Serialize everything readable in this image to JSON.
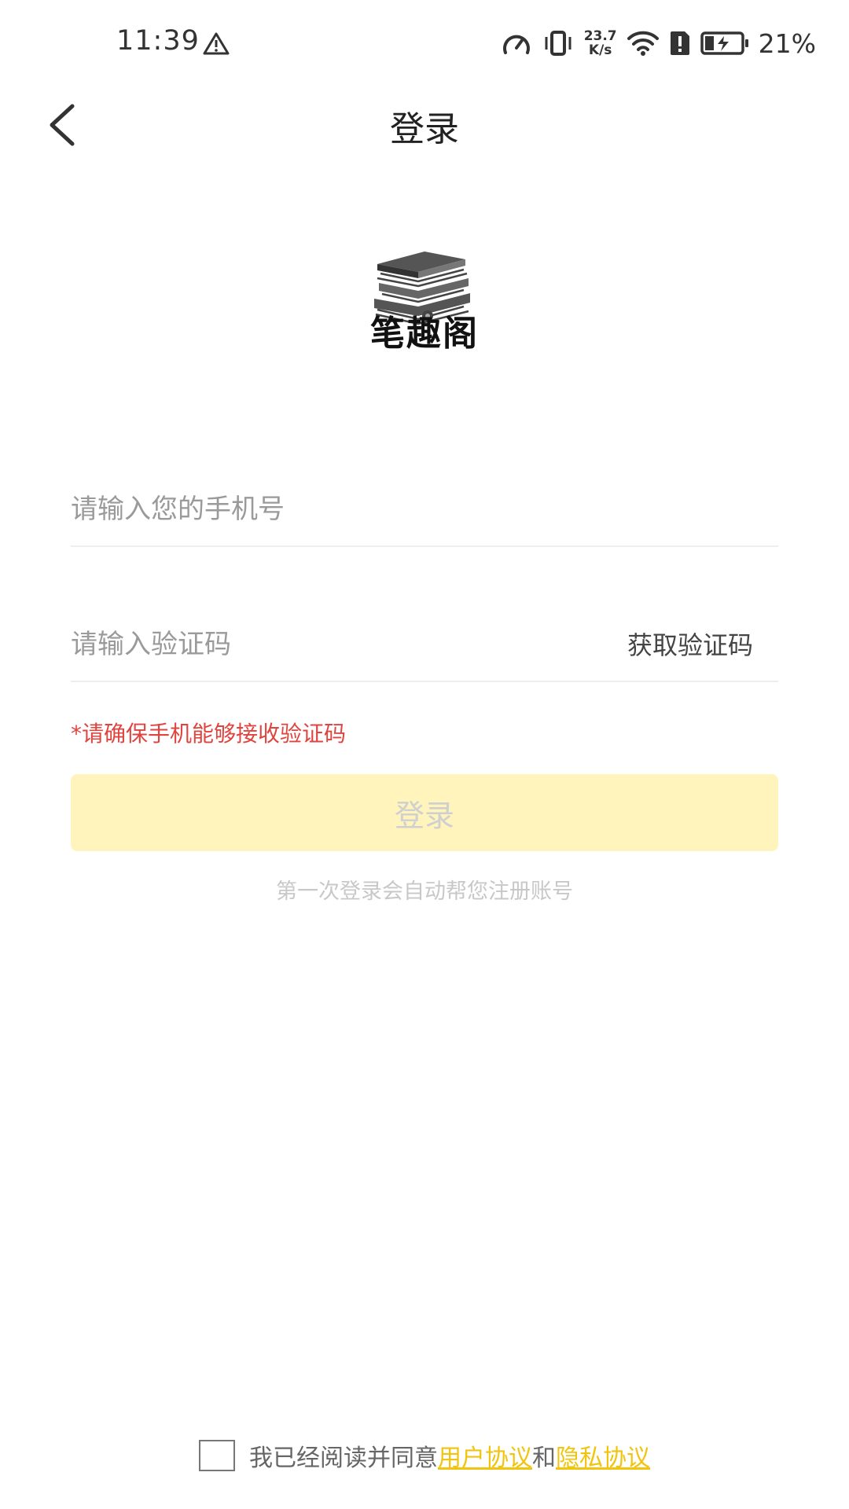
{
  "status_bar": {
    "time": "11:39",
    "net_speed_value": "23.7",
    "net_speed_unit": "K/s",
    "battery_percent": "21%"
  },
  "header": {
    "title": "登录"
  },
  "logo": {
    "app_name": "笔趣阁"
  },
  "form": {
    "phone_placeholder": "请输入您的手机号",
    "code_placeholder": "请输入验证码",
    "get_code_label": "获取验证码",
    "hint": "*请确保手机能够接收验证码",
    "login_label": "登录",
    "auto_register_note": "第一次登录会自动帮您注册账号"
  },
  "agreement": {
    "prefix": "我已经阅读并同意",
    "user_agreement": "用户协议",
    "conjunction": "和",
    "privacy_agreement": "隐私协议",
    "checked": false
  },
  "colors": {
    "link": "#f1c40f",
    "login_button_bg": "#fff4bc",
    "hint": "#e0443f"
  }
}
